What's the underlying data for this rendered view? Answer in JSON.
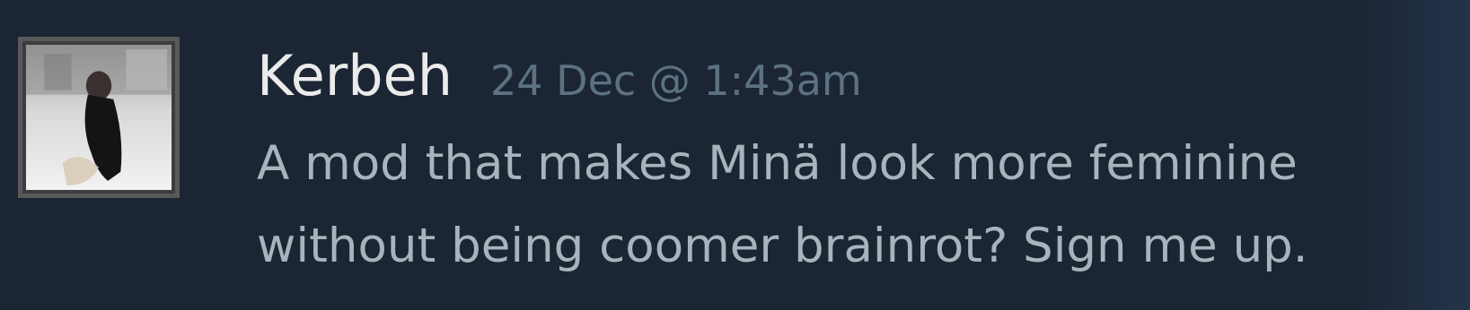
{
  "comment": {
    "author": "Kerbeh",
    "timestamp": "24 Dec @ 1:43am",
    "text": "A mod that makes Minä look more feminine\nwithout being coomer brainrot? Sign me up."
  },
  "colors": {
    "background": "#1b2533",
    "author": "#ebebeb",
    "timestamp": "#5c7182",
    "text": "#a9b3bc",
    "avatar_border": "#595959"
  },
  "icons": {
    "avatar": "user-avatar-image"
  }
}
